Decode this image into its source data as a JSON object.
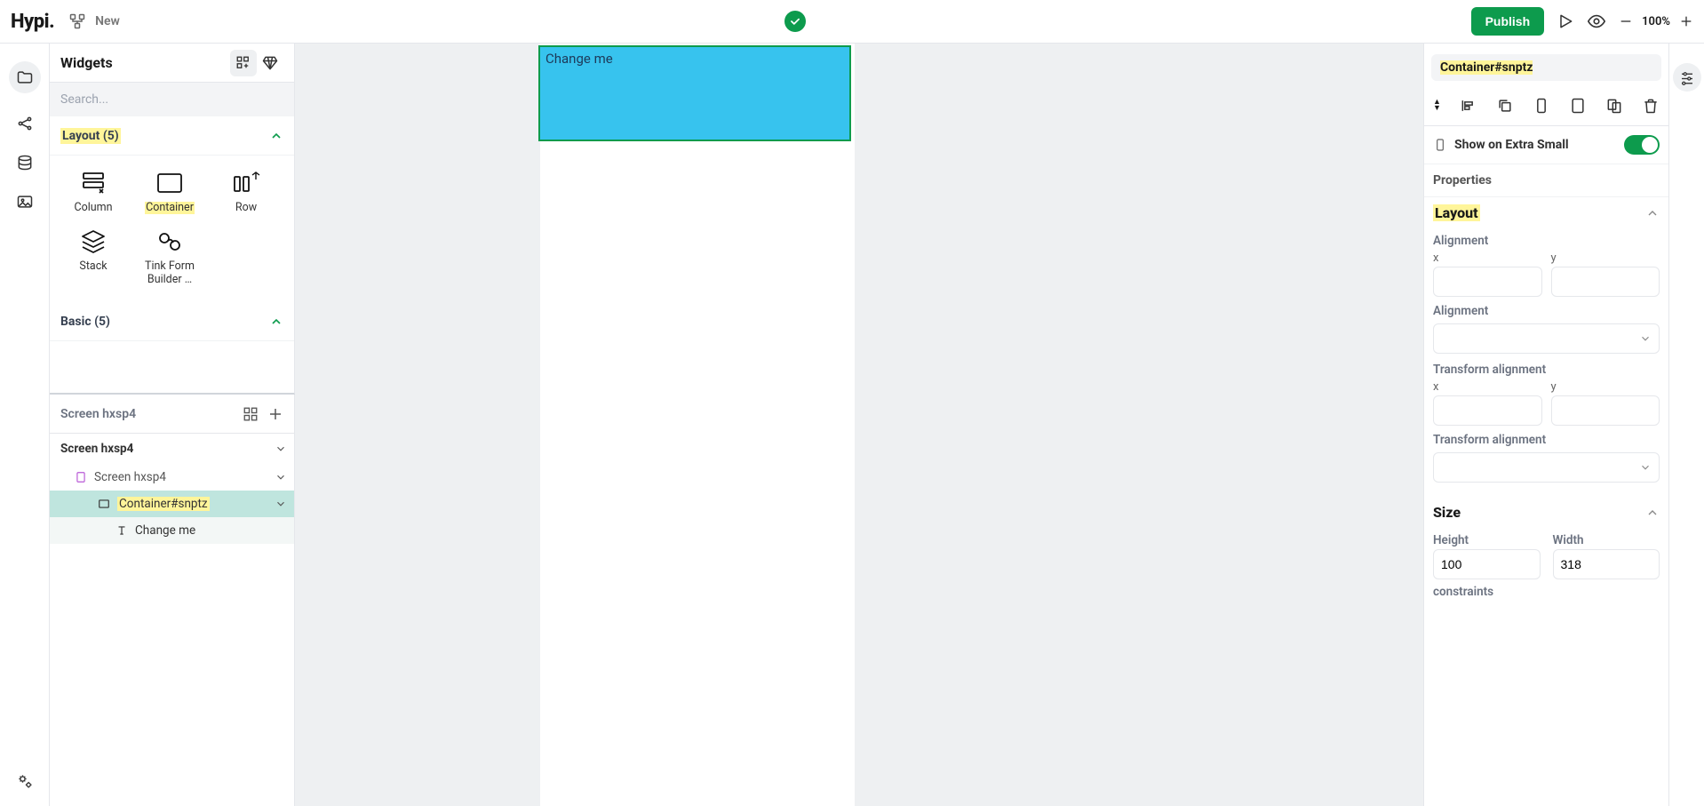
{
  "topbar": {
    "logo": "Hypi.",
    "new": "New",
    "publish": "Publish",
    "zoom": "100%"
  },
  "widgets": {
    "title": "Widgets",
    "search_placeholder": "Search...",
    "sections": {
      "layout": {
        "title": "Layout (5)",
        "items": [
          "Column",
          "Container",
          "Row",
          "Stack",
          "Tink Form Builder …"
        ]
      },
      "basic": {
        "title": "Basic (5)"
      }
    }
  },
  "tree": {
    "head": "Screen hxsp4",
    "root": "Screen hxsp4",
    "lvl1": "Screen hxsp4",
    "lvl2": "Container#snptz",
    "lvl3": "Change me"
  },
  "canvas": {
    "container_text": "Change me"
  },
  "props": {
    "title": "Container#snptz",
    "show_on": "Show on Extra Small",
    "properties": "Properties",
    "layout": {
      "title": "Layout",
      "alignment_label": "Alignment",
      "x": "x",
      "y": "y",
      "alignment2": "Alignment",
      "transform_alignment": "Transform alignment",
      "transform_alignment2": "Transform alignment"
    },
    "size": {
      "title": "Size",
      "height_label": "Height",
      "width_label": "Width",
      "height": "100",
      "width": "318",
      "constraints": "constraints"
    }
  }
}
